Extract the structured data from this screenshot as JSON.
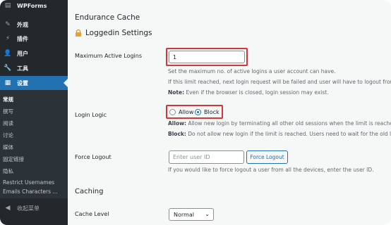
{
  "sidebar": {
    "top_item": "WPForms",
    "items": [
      {
        "label": "外观",
        "icon": "paintbrush-icon"
      },
      {
        "label": "插件",
        "icon": "plugin-icon"
      },
      {
        "label": "用户",
        "icon": "users-icon"
      },
      {
        "label": "工具",
        "icon": "wrench-icon"
      },
      {
        "label": "设置",
        "icon": "settings-icon",
        "active": true
      }
    ],
    "submenu": [
      "常规",
      "撰写",
      "阅读",
      "讨论",
      "媒体",
      "固定链接",
      "隐私",
      "Restrict Usernames",
      "Emails Characters ..."
    ],
    "collapse_label": "收起菜单"
  },
  "main": {
    "section_title": "Endurance Cache",
    "settings_title": "Loggedin Settings",
    "max_logins": {
      "label": "Maximum Active Logins",
      "value": "1",
      "desc1": "Set the maximum no. of active logins a user account can have.",
      "desc2": "If this limit reached, next login request will be failed and user will have to logout from",
      "note_bold": "Note:",
      "note_text": " Even if the browser is closed, login session may exist."
    },
    "login_logic": {
      "label": "Login Logic",
      "option_allow": "Allow",
      "option_block": "Block",
      "selected": "Block",
      "allow_bold": "Allow:",
      "allow_text": " Allow new login by terminating all other old sessions when the limit is reache",
      "block_bold": "Block:",
      "block_text": " Do not allow new login if the limit is reached. Users need to wait for the old l"
    },
    "force_logout": {
      "label": "Force Logout",
      "placeholder": "Enter user ID",
      "button": "Force Logout",
      "desc": "If you would like to force logout a user from all the devices, enter the user ID."
    },
    "caching_title": "Caching",
    "cache_level": {
      "label": "Cache Level",
      "value": "Normal"
    }
  },
  "colors": {
    "sidebar_bg": "#23282d",
    "active_bg": "#2271b1",
    "highlight_red": "#d63638"
  }
}
